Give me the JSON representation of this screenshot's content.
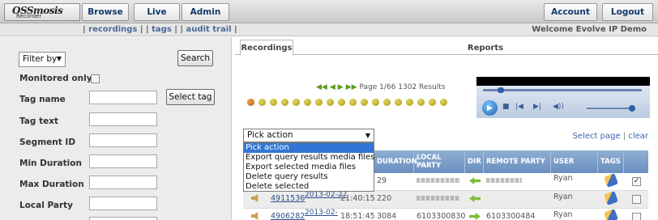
{
  "app": {
    "logo_text": "OSSmosis",
    "logo_sub": "Recorder"
  },
  "nav": {
    "browse": "Browse",
    "live": "Live",
    "admin": "Admin",
    "account": "Account",
    "logout": "Logout"
  },
  "subnav": {
    "sep_open": "| ",
    "recordings": "recordings",
    "sep1": " | | ",
    "tags": "tags",
    "sep2": " | | ",
    "audit": "audit trail",
    "sep_close": " |",
    "welcome": "Welcome Evolve IP Demo"
  },
  "filters": {
    "filter_by": "Filter by",
    "search_button": "Search",
    "monitored_only": "Monitored only",
    "tag_name": "Tag name",
    "select_tag_button": "Select tag",
    "tag_text": "Tag text",
    "segment_id": "Segment ID",
    "min_duration": "Min Duration",
    "max_duration": "Max Duration",
    "local_party": "Local Party"
  },
  "tabs": {
    "recordings": "Recordings",
    "reports": "Reports"
  },
  "pager": {
    "text": "Page 1/66 1302 Results"
  },
  "select_links": {
    "select_page": "Select page",
    "sep": " | ",
    "clear": "clear"
  },
  "action_dropdown": {
    "selected": "Pick action",
    "options": [
      "Pick action",
      "Export query results media files",
      "Export selected media files",
      "Delete query results",
      "Delete selected"
    ]
  },
  "table": {
    "headers": {
      "duration": "DURATION",
      "local_party": "LOCAL PARTY",
      "dir": "DIR",
      "remote_party": "REMOTE PARTY",
      "user": "USER",
      "tags": "TAGS"
    },
    "rows": [
      {
        "duration": "29",
        "user": "Ryan",
        "checked": true
      },
      {
        "id": "4911536",
        "date": "2013-02-27",
        "time": "21:40:15",
        "duration": "220",
        "user": "Ryan",
        "checked": false
      },
      {
        "id": "4906282",
        "date": "2013-02-",
        "time": "18:51:45",
        "duration": "3084",
        "local_party": "6103300830",
        "remote_party": "6103300484",
        "user": "Ryan",
        "checked": false
      }
    ]
  },
  "colors": {
    "header_blue": "#6b8fbf",
    "link_blue": "#2d4f8b",
    "highlight": "#3176d4"
  }
}
